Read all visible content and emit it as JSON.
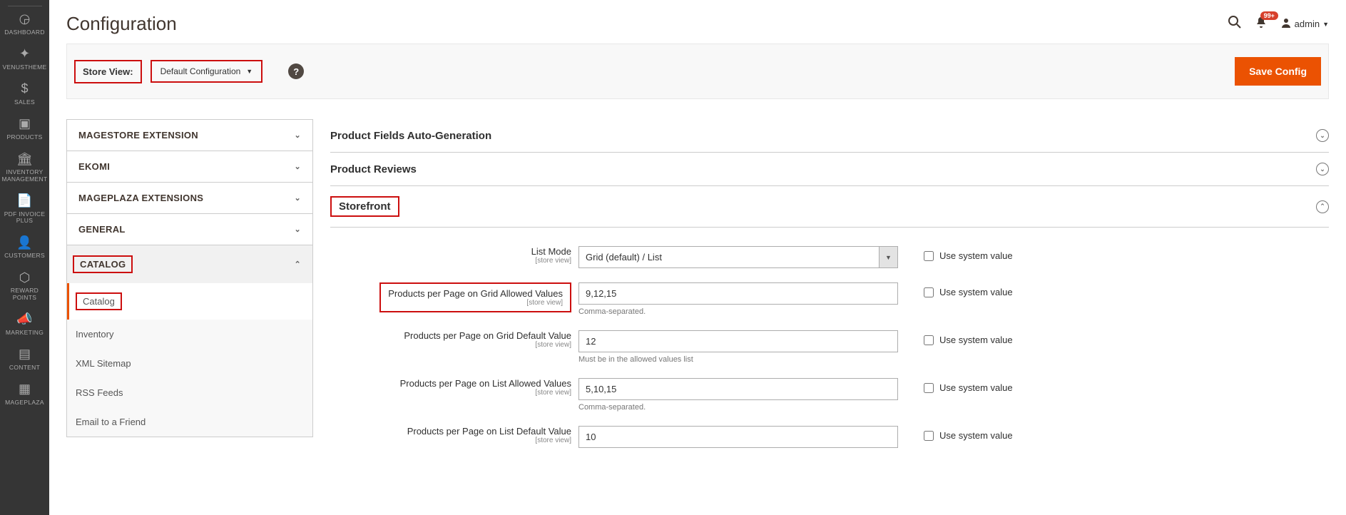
{
  "page_title": "Configuration",
  "sidebar": {
    "items": [
      {
        "label": "DASHBOARD",
        "icon": "◷"
      },
      {
        "label": "VENUSTHEME",
        "icon": "✦"
      },
      {
        "label": "SALES",
        "icon": "$"
      },
      {
        "label": "PRODUCTS",
        "icon": "▣"
      },
      {
        "label": "INVENTORY MANAGEMENT",
        "icon": "🏛"
      },
      {
        "label": "PDF INVOICE PLUS",
        "icon": "📄"
      },
      {
        "label": "CUSTOMERS",
        "icon": "👤"
      },
      {
        "label": "REWARD POINTS",
        "icon": "⬡"
      },
      {
        "label": "MARKETING",
        "icon": "📣"
      },
      {
        "label": "CONTENT",
        "icon": "▤"
      },
      {
        "label": "MAGEPLAZA",
        "icon": "▦"
      }
    ]
  },
  "header": {
    "notification_count": "99+",
    "account_label": "admin"
  },
  "storebar": {
    "label": "Store View:",
    "value": "Default Configuration",
    "save_label": "Save Config"
  },
  "left_tabs": [
    {
      "label": "MAGESTORE EXTENSION",
      "open": false
    },
    {
      "label": "EKOMI",
      "open": false
    },
    {
      "label": "MAGEPLAZA EXTENSIONS",
      "open": false
    },
    {
      "label": "GENERAL",
      "open": false
    },
    {
      "label": "CATALOG",
      "open": true,
      "highlighted": true
    }
  ],
  "catalog_sub": [
    {
      "label": "Catalog",
      "current": true,
      "highlighted": true
    },
    {
      "label": "Inventory"
    },
    {
      "label": "XML Sitemap"
    },
    {
      "label": "RSS Feeds"
    },
    {
      "label": "Email to a Friend"
    }
  ],
  "sections": {
    "s1": "Product Fields Auto-Generation",
    "s2": "Product Reviews",
    "s3": "Storefront"
  },
  "fields": {
    "list_mode": {
      "label": "List Mode",
      "scope": "[store view]",
      "value": "Grid (default) / List"
    },
    "grid_allowed": {
      "label": "Products per Page on Grid Allowed Values",
      "scope": "[store view]",
      "value": "9,12,15",
      "note": "Comma-separated."
    },
    "grid_default": {
      "label": "Products per Page on Grid Default Value",
      "scope": "[store view]",
      "value": "12",
      "note": "Must be in the allowed values list"
    },
    "list_allowed": {
      "label": "Products per Page on List Allowed Values",
      "scope": "[store view]",
      "value": "5,10,15",
      "note": "Comma-separated."
    },
    "list_default": {
      "label": "Products per Page on List Default Value",
      "scope": "[store view]",
      "value": "10"
    }
  },
  "sys_label": "Use system value"
}
